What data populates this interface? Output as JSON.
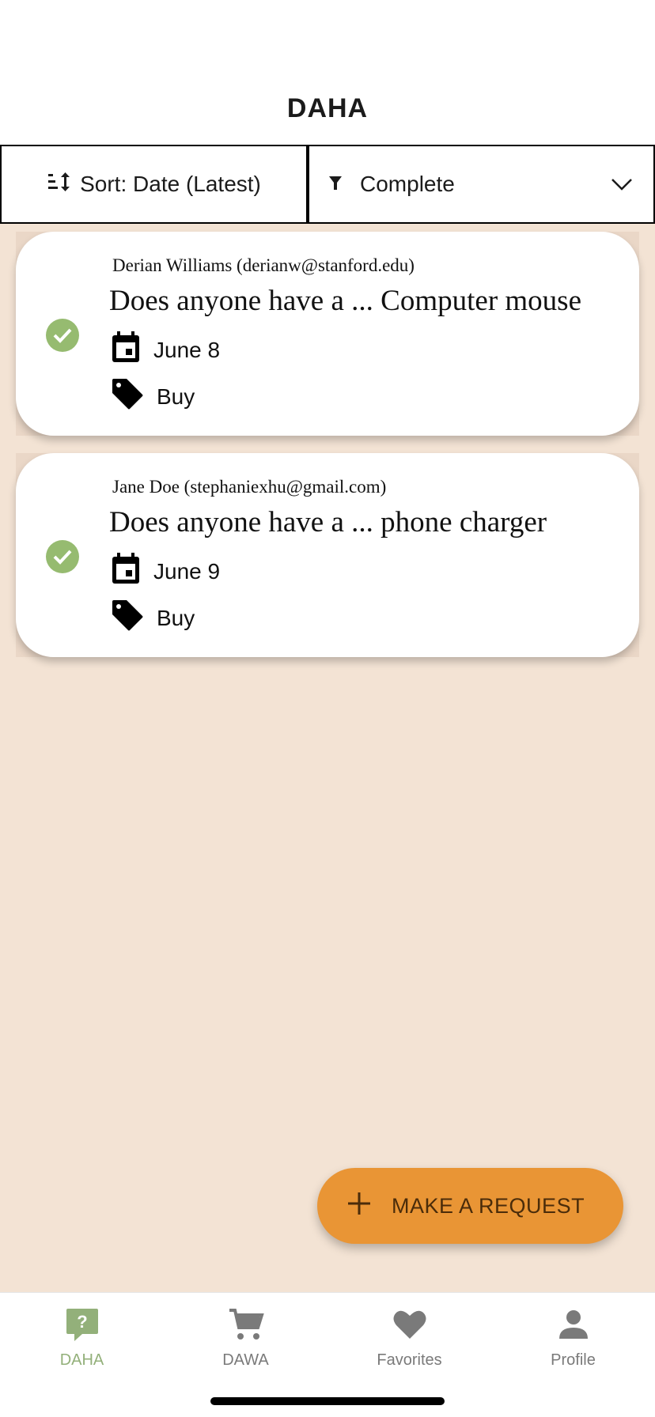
{
  "header": {
    "title": "DAHA"
  },
  "toolbar": {
    "sort_label": "Sort: Date (Latest)",
    "filter_label": "Complete"
  },
  "requests": [
    {
      "author": "Derian Williams (derianw@stanford.edu)",
      "title": "Does anyone have a ... Computer mouse",
      "date": "June 8",
      "type": "Buy",
      "status": "complete"
    },
    {
      "author": "Jane Doe (stephaniexhu@gmail.com)",
      "title": "Does anyone have a ... phone charger",
      "date": "June 9",
      "type": "Buy",
      "status": "complete"
    }
  ],
  "fab": {
    "label": "MAKE A REQUEST",
    "icon": "plus-icon"
  },
  "nav": {
    "items": [
      {
        "label": "DAHA",
        "icon": "question-bubble-icon",
        "active": true
      },
      {
        "label": "DAWA",
        "icon": "cart-icon",
        "active": false
      },
      {
        "label": "Favorites",
        "icon": "heart-icon",
        "active": false
      },
      {
        "label": "Profile",
        "icon": "person-icon",
        "active": false
      }
    ]
  },
  "colors": {
    "background": "#f3e3d4",
    "accent": "#e99535",
    "check": "#96bb70",
    "nav_active": "#93b07a"
  }
}
